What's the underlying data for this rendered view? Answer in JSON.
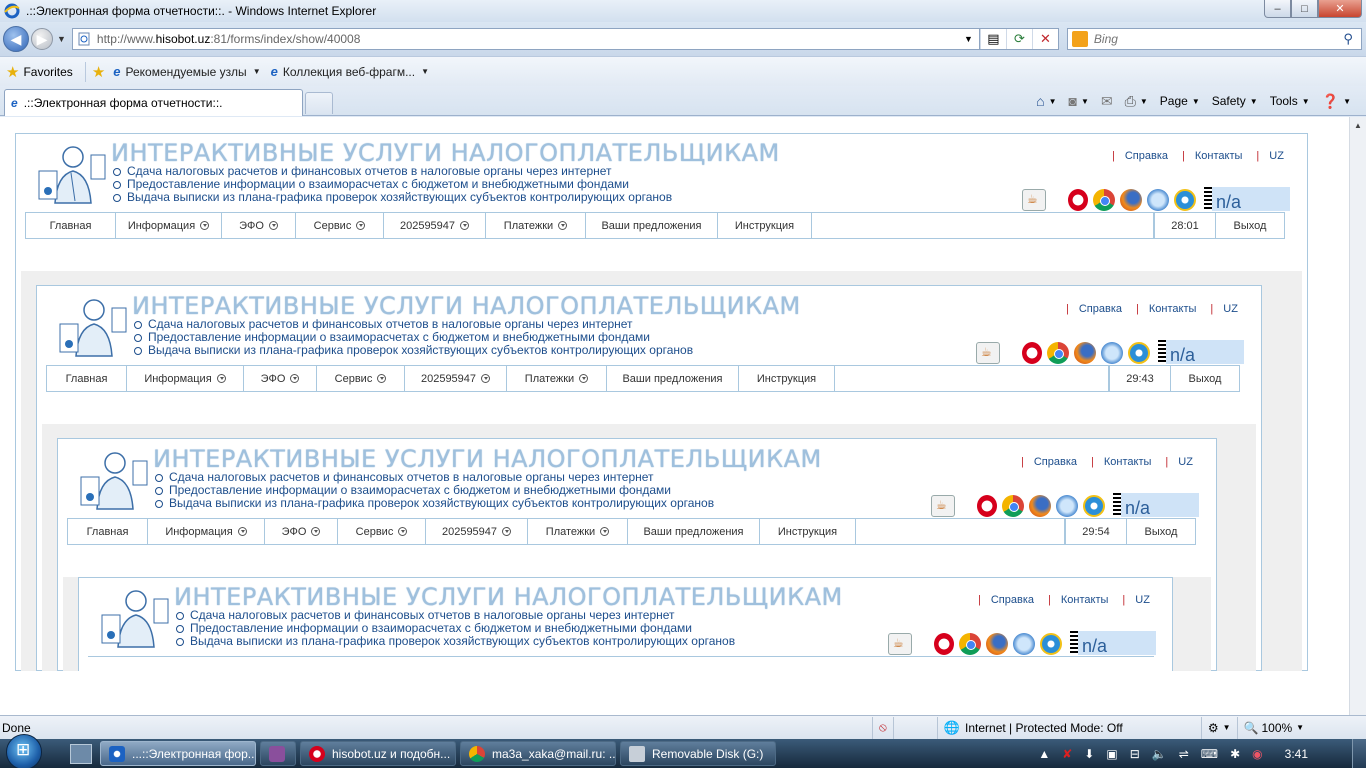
{
  "window": {
    "title": ".::Электронная форма отчетности::. - Windows Internet Explorer",
    "min": "–",
    "max": "□",
    "close": "✕"
  },
  "address": {
    "url_prefix": "http://www.",
    "url_host": "hisobot.uz",
    "url_path": ":81/forms/index/show/40008",
    "search_placeholder": "Bing"
  },
  "favorites": {
    "label": "Favorites",
    "links": [
      "Рекомендуемые узлы",
      "Коллекция веб-фрагм..."
    ]
  },
  "tabs": {
    "active": ".::Электронная форма отчетности::."
  },
  "commandbar": {
    "page": "Page",
    "safety": "Safety",
    "tools": "Tools"
  },
  "site": {
    "title": "ИНТЕРАКТИВНЫЕ УСЛУГИ НАЛОГОПЛАТЕЛЬЩИКАМ",
    "bullets": [
      "Сдача налоговых расчетов и финансовых отчетов в налоговые органы через интернет",
      "Предоставление информации о взаиморасчетах с бюджетом и внебюджетными фондами",
      "Выдача выписки из плана-графика проверок хозяйствующих субъектов контролирующих органов"
    ],
    "toplinks": {
      "help": "Справка",
      "contacts": "Контакты",
      "lang": "UZ"
    },
    "na": "n/a",
    "menu": {
      "home": "Главная",
      "info": "Информация",
      "efo": "ЭФО",
      "service": "Сервис",
      "tin": "202595947",
      "payments": "Платежки",
      "suggestions": "Ваши предложения",
      "manual": "Инструкция",
      "exit": "Выход"
    },
    "timers": [
      "28:01",
      "29:43",
      "29:54"
    ]
  },
  "status": {
    "text": "Done",
    "zone": "Internet | Protected Mode: Off",
    "zoom": "100%"
  },
  "taskbar": {
    "items": [
      "...::Электронная фор...",
      "",
      "hisobot.uz и подобн...",
      "ma3a_xaka@mail.ru: ...",
      "Removable Disk (G:)"
    ],
    "clock": "3:41"
  }
}
